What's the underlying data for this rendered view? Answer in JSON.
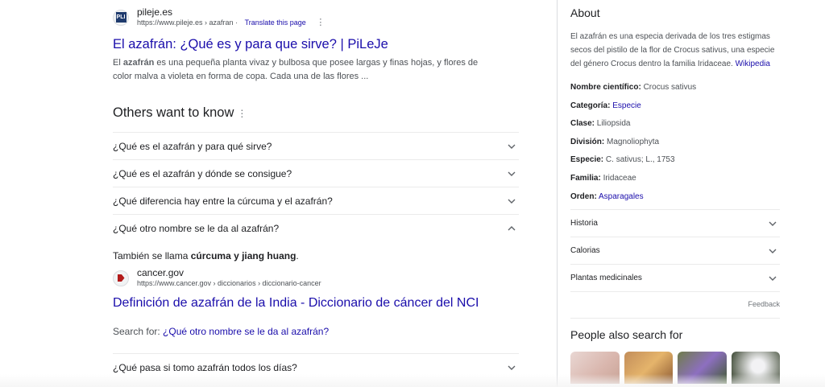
{
  "result1": {
    "site": "pileje.es",
    "favicon": "PLI",
    "url": "https://www.pileje.es › azafran",
    "translate": "Translate this page",
    "title": "El azafrán: ¿Qué es y para que sirve? | PiLeJe",
    "snippet_pre": "El ",
    "snippet_bold": "azafrán",
    "snippet_post": " es una pequeña planta vivaz y bulbosa que posee largas y finas hojas, y flores de color malva a violeta en forma de copa. Cada una de las flores ..."
  },
  "paa": {
    "title": "Others want to know",
    "questions": [
      "¿Qué es el azafrán y para qué sirve?",
      "¿Qué es el azafrán y dónde se consigue?",
      "¿Qué diferencia hay entre la cúrcuma y el azafrán?",
      "¿Qué otro nombre se le da al azafrán?"
    ],
    "answer": {
      "text_pre": "También se llama ",
      "text_bold": "cúrcuma y jiang huang",
      "text_post": ".",
      "site": "cancer.gov",
      "url": "https://www.cancer.gov › diccionarios › diccionario-cancer",
      "title": "Definición de azafrán de la India - Diccionario de cáncer del NCI",
      "search_for_label": "Search for: ",
      "search_for_link": "¿Qué otro nombre se le da al azafrán?"
    },
    "last_question": "¿Qué pasa si tomo azafrán todos los días?"
  },
  "kp": {
    "heading": "About",
    "description": "El azafrán es una especia derivada de los tres estigmas secos del pistilo de la flor de Crocus sativus, una especie del género Crocus dentro la familia Iridaceae. ",
    "wiki": "Wikipedia",
    "facts": [
      {
        "label": "Nombre científico:",
        "value": "Crocus sativus",
        "link": false
      },
      {
        "label": "Categoría:",
        "value": "Especie",
        "link": true
      },
      {
        "label": "Clase:",
        "value": "Liliopsida",
        "link": false
      },
      {
        "label": "División:",
        "value": "Magnoliophyta",
        "link": false
      },
      {
        "label": "Especie:",
        "value": "C. sativus; L., 1753",
        "link": false
      },
      {
        "label": "Familia:",
        "value": "Iridaceae",
        "link": false
      },
      {
        "label": "Orden:",
        "value": "Asparagales",
        "link": true
      }
    ],
    "rows": [
      "Historia",
      "Calorias",
      "Plantas medicinales"
    ],
    "feedback": "Feedback",
    "pas_heading": "People also search for"
  }
}
